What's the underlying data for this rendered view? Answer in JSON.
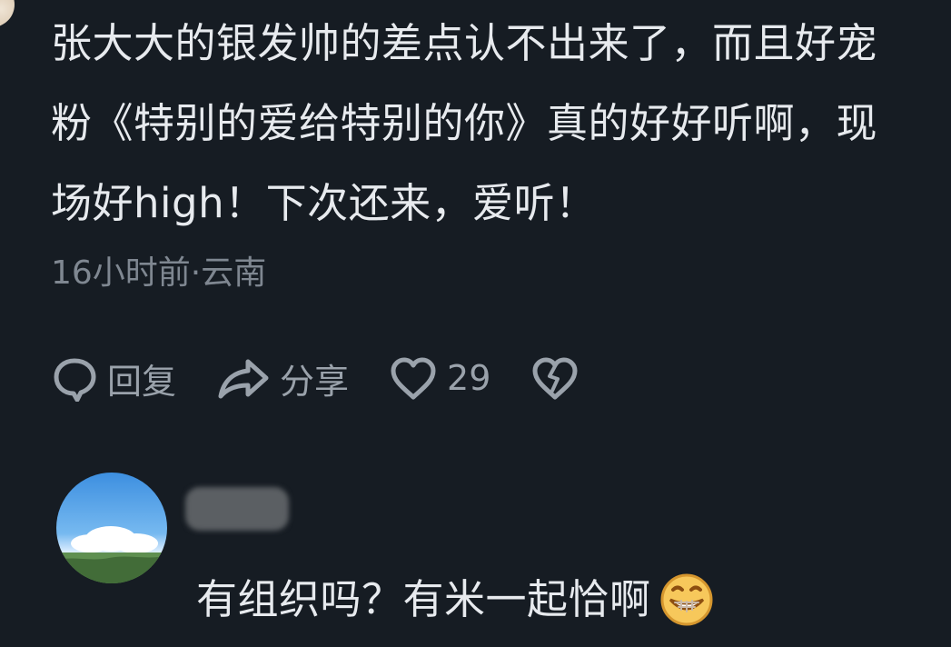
{
  "comment": {
    "text": "张大大的银发帅的差点认不出来了，而且好宠粉《特别的爱给特别的你》真的好好听啊，现场好high！下次还来，爱听！",
    "meta": "16小时前·云南"
  },
  "actions": {
    "reply_label": "回复",
    "share_label": "分享",
    "like_count": "29",
    "icons": [
      "comment-bubble-icon",
      "share-arrow-icon",
      "heart-icon",
      "broken-heart-icon"
    ]
  },
  "reply": {
    "text": "有组织吗？有米一起恰啊",
    "emoji": "grin-emoji",
    "username_obscured": true
  },
  "colors": {
    "background": "#161c23",
    "primary_text": "#e7eaee",
    "secondary_text": "#7f8791",
    "icon": "#9aa2ab",
    "emoji_face": "#f7c85b"
  }
}
